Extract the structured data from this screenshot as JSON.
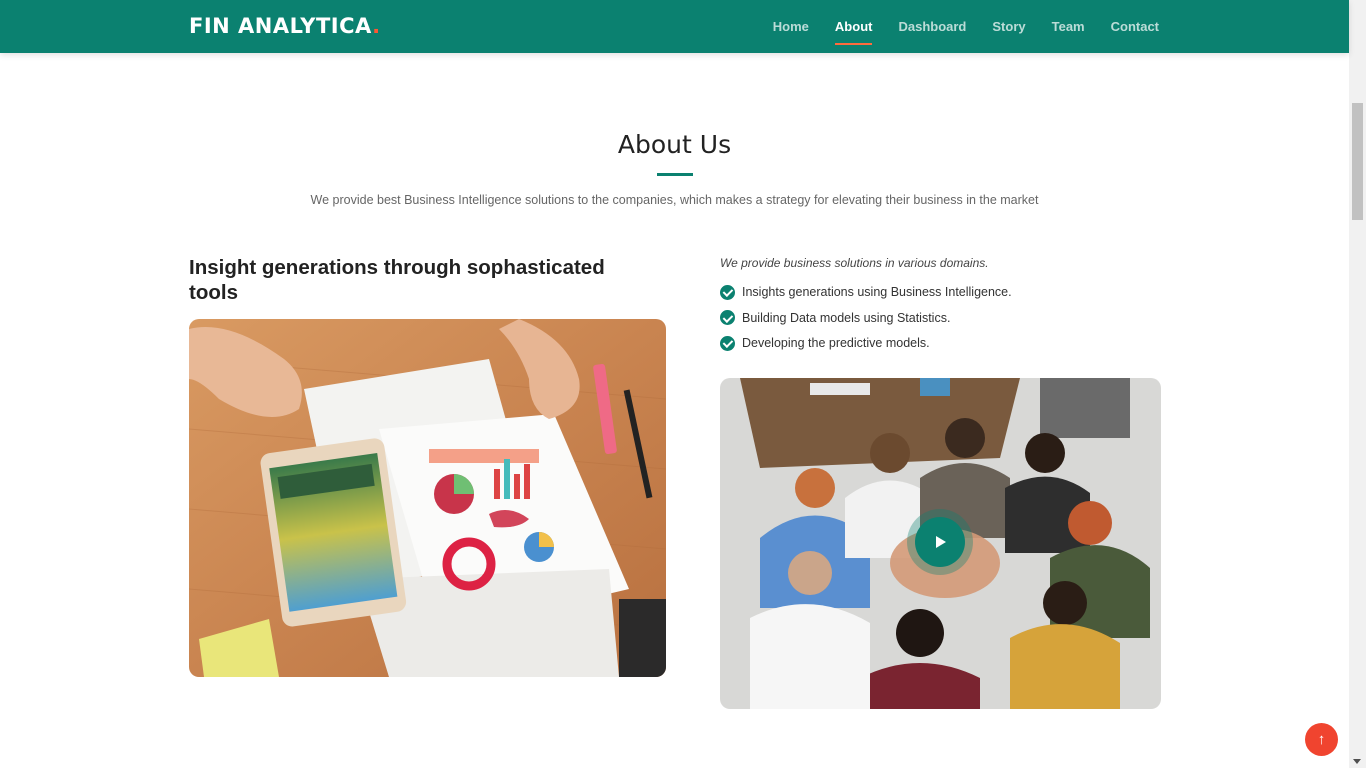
{
  "header": {
    "logo_text": "FIN ANALYTICA",
    "logo_dot": ".",
    "nav": [
      {
        "label": "Home",
        "active": false
      },
      {
        "label": "About",
        "active": true
      },
      {
        "label": "Dashboard",
        "active": false
      },
      {
        "label": "Story",
        "active": false
      },
      {
        "label": "Team",
        "active": false
      },
      {
        "label": "Contact",
        "active": false
      }
    ]
  },
  "about": {
    "title": "About Us",
    "subtitle": "We provide best Business Intelligence solutions to the companies, which makes a strategy for elevating their business in the market",
    "left_heading": "Insight generations through sophasticated tools",
    "right_intro": "We provide business solutions in various domains.",
    "features": [
      "Insights generations using Business Intelligence.",
      "Building Data models using Statistics.",
      "Developing the predictive models."
    ]
  },
  "icons": {
    "feature_bullet": "check-circle-icon",
    "video": "play-icon",
    "back_to_top": "arrow-up-icon",
    "back_to_top_glyph": "↑"
  },
  "colors": {
    "primary": "#0b8170",
    "accent": "#ff5733",
    "back_to_top": "#f0442f"
  }
}
